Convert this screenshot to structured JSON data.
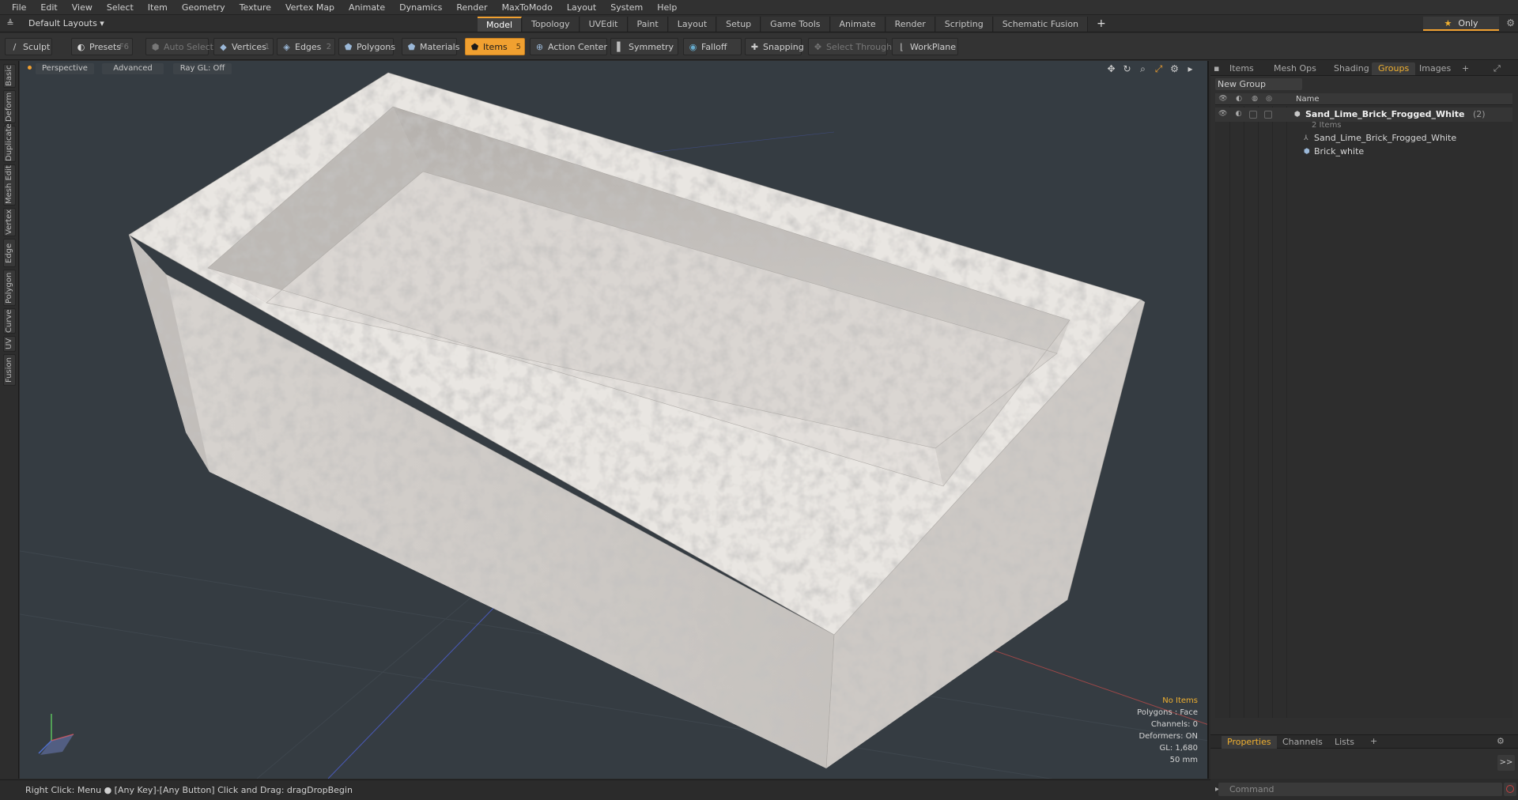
{
  "menu": [
    "File",
    "Edit",
    "View",
    "Select",
    "Item",
    "Geometry",
    "Texture",
    "Vertex Map",
    "Animate",
    "Dynamics",
    "Render",
    "MaxToModo",
    "Layout",
    "System",
    "Help"
  ],
  "layout": {
    "layouts_label": "Default Layouts ▾",
    "tabs": [
      "Model",
      "Topology",
      "UVEdit",
      "Paint",
      "Layout",
      "Setup",
      "Game Tools",
      "Animate",
      "Render",
      "Scripting",
      "Schematic Fusion"
    ],
    "active_tab": "Model",
    "plus": "+",
    "only_label": "Only"
  },
  "toolbar": {
    "sculpt": "Sculpt",
    "presets": "Presets",
    "presets_key": "F6",
    "auto_select": "Auto Select",
    "vertices": "Vertices",
    "vertices_count": "1",
    "edges": "Edges",
    "edges_count": "2",
    "polygons": "Polygons",
    "materials": "Materials",
    "items": "Items",
    "items_count": "5",
    "action_center": "Action Center",
    "symmetry": "Symmetry",
    "falloff": "Falloff",
    "snapping": "Snapping",
    "select_through": "Select Through",
    "workplane": "WorkPlane"
  },
  "left_tabs": [
    "Basic",
    "Deform",
    "Duplicate",
    "Mesh Edit",
    "Vertex",
    "Edge",
    "Polygon",
    "Curve",
    "UV",
    "Fusion"
  ],
  "viewport": {
    "view": "Perspective",
    "shading": "Advanced",
    "raygl": "Ray GL: Off",
    "stats": {
      "selection": "No Items",
      "polygons": "Polygons : Face",
      "channels": "Channels: 0",
      "deformers": "Deformers: ON",
      "gl": "GL: 1,680",
      "grid": "50 mm"
    }
  },
  "right_panel": {
    "tabs": [
      "Items",
      "Mesh Ops",
      "Shading",
      "Groups",
      "Images"
    ],
    "active_tab": "Groups",
    "plus": "+",
    "new_group": "New Group",
    "col_name": "Name",
    "group": {
      "name": "Sand_Lime_Brick_Frogged_White",
      "count": "(2)",
      "subtitle": "2 Items",
      "children": [
        "Sand_Lime_Brick_Frogged_White",
        "Brick_white"
      ]
    },
    "bottom_tabs": [
      "Properties",
      "Channels",
      "Lists"
    ],
    "bottom_active": "Properties",
    "bottom_plus": "+",
    "expand": ">>"
  },
  "status": {
    "text": "Right Click: Menu ●  [Any Key]-[Any Button] Click and Drag: dragDropBegin",
    "command_placeholder": "Command"
  },
  "colors": {
    "accent": "#f0a030",
    "viewport_bg": "#353c42",
    "brick": "#e6e2de"
  }
}
